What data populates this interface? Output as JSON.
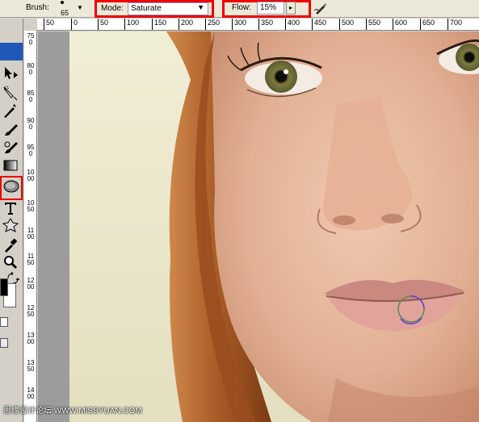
{
  "options_bar": {
    "brush_label": "Brush:",
    "brush_size": "65",
    "mode_label": "Mode:",
    "mode_value": "Saturate",
    "flow_label": "Flow:",
    "flow_value": "15%"
  },
  "ruler_top": {
    "ticks": [
      "50",
      "0",
      "50",
      "100",
      "150",
      "200",
      "250",
      "300",
      "350",
      "400",
      "450",
      "500",
      "550",
      "600",
      "650",
      "700"
    ]
  },
  "ruler_left": {
    "labels": [
      "750",
      "800",
      "850",
      "900",
      "950",
      "1000",
      "1050",
      "1100",
      "1150",
      "1200",
      "1250",
      "1300",
      "1350",
      "1400"
    ]
  },
  "toolbox": {
    "tools": [
      "move-icon",
      "lasso-icon",
      "magic-wand-icon",
      "brush-icon",
      "history-brush-icon",
      "gradient-icon",
      "sponge-icon",
      "type-icon",
      "custom-shape-icon",
      "eyedropper-icon",
      "zoom-icon",
      "swap-colors-icon"
    ],
    "active_tool": "sponge-icon"
  },
  "colors": {
    "highlight_red": "#ee0000",
    "canvas_bg": "#f2efd8",
    "hair": "#b5652a",
    "skin": "#e8b59a"
  },
  "watermark": "思缘设计论坛 WWW.MISSYUAN.COM"
}
